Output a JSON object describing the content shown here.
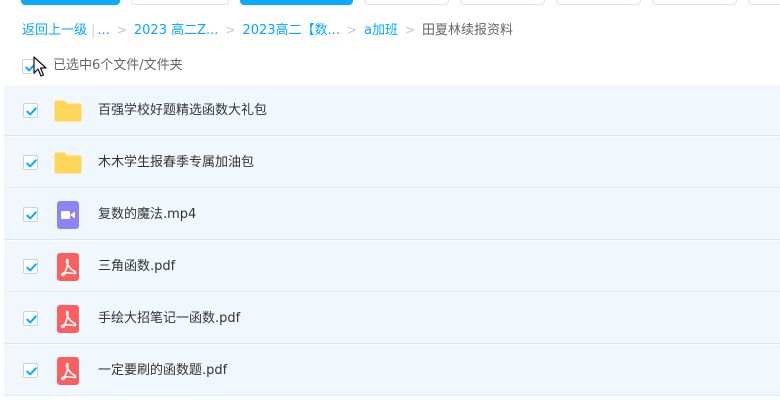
{
  "colors": {
    "accent": "#09aaff",
    "link": "#06a7ff",
    "row_bg": "#f0f8fe",
    "folder": "#ffd65b",
    "video": "#8c84f3",
    "pdf": "#fb5f5f"
  },
  "breadcrumb": {
    "back": "返回上一级",
    "ellipsis": "...",
    "items": [
      "2023 高二Z...",
      "2023高二【数...",
      "a加班"
    ],
    "current": "田夏林续报资料"
  },
  "selection": {
    "checked": true,
    "label": "已选中6个文件/文件夹"
  },
  "files": [
    {
      "name": "百强学校好题精选函数大礼包",
      "type": "folder",
      "icon": "folder-icon",
      "checked": true
    },
    {
      "name": "木木学生报春季专属加油包",
      "type": "folder",
      "icon": "folder-icon",
      "checked": true
    },
    {
      "name": "复数的魔法.mp4",
      "type": "video",
      "icon": "video-file-icon",
      "checked": true
    },
    {
      "name": "三角函数.pdf",
      "type": "pdf",
      "icon": "pdf-file-icon",
      "checked": true
    },
    {
      "name": "手绘大招笔记一函数.pdf",
      "type": "pdf",
      "icon": "pdf-file-icon",
      "checked": true
    },
    {
      "name": "一定要刷的函数题.pdf",
      "type": "pdf",
      "icon": "pdf-file-icon",
      "checked": true
    }
  ]
}
